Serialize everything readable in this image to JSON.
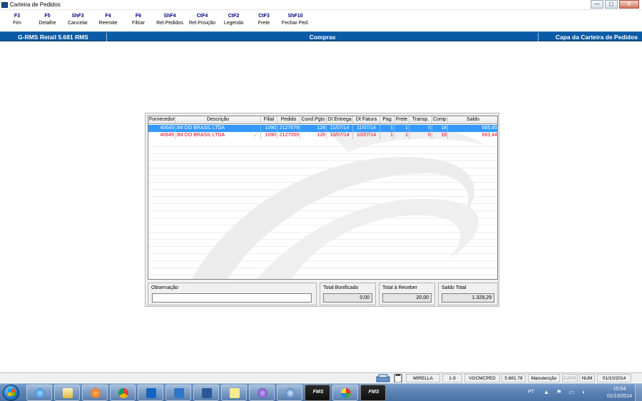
{
  "window": {
    "title": "Carteira de Pedidos",
    "controls": {
      "minimize": "—",
      "maximize": "◻",
      "close": "✕"
    }
  },
  "toolbar": [
    {
      "key": "F3",
      "label": "Fim"
    },
    {
      "key": "F5",
      "label": "Detalhe"
    },
    {
      "key": "ShF3",
      "label": "Cancelar"
    },
    {
      "key": "F4",
      "label": "Reemite"
    },
    {
      "key": "F6",
      "label": "Filtrar"
    },
    {
      "key": "ShF4",
      "label": "Rel.Pedidos"
    },
    {
      "key": "CtF4",
      "label": "Rel.Posição"
    },
    {
      "key": "CtF2",
      "label": "Legenda"
    },
    {
      "key": "CtF3",
      "label": "Frete"
    },
    {
      "key": "ShF10",
      "label": "Fechar Ped."
    }
  ],
  "header_bar": {
    "system": "G-RMS Retail 5.681 RMS",
    "module": "Compras",
    "screen": "Capa da Carteira de Pedidos",
    "color": "#0b5aa5"
  },
  "grid": {
    "columns": [
      "Fornecedor",
      "Descrição",
      "Filial",
      "Pedido",
      "Cond.Pgto",
      "Dt Entrega",
      "Dt Fatura",
      "Pag",
      "Frete",
      "Transp.",
      "Comp",
      "Saldo"
    ],
    "rows": [
      {
        "fornecedor": "40649",
        "descricao": "3M DO BRASIL LTDA",
        "checked": false,
        "filial": "1090",
        "pedido": "2127679",
        "cond_pgto": "128",
        "dt_entrega": "11/07/14",
        "dt_fatura": "11/07/14",
        "pag": "1",
        "frete": "1",
        "transp": "0",
        "comp": "18",
        "saldo": "665,85",
        "state": "selected"
      },
      {
        "fornecedor": "40649",
        "descricao": "3M DO BRASIL LTDA",
        "checked": true,
        "check_glyph": "✓",
        "filial": "1090",
        "pedido": "2127059",
        "cond_pgto": "128",
        "dt_entrega": "10/07/14",
        "dt_fatura": "10/07/14",
        "pag": "1",
        "frete": "1",
        "transp": "0",
        "comp": "18",
        "saldo": "663,44",
        "state": "red"
      }
    ],
    "selected_color": "#3399ff",
    "red_color": "#e0001b"
  },
  "observacao": {
    "label": "Observação",
    "value": ""
  },
  "totals": {
    "bonificado": {
      "label": "Total Bonificado",
      "value": "0,00"
    },
    "receber": {
      "label": "Total à Receber",
      "value": "20,00"
    },
    "saldo": {
      "label": "Saldo Total",
      "value": "1.329,29"
    }
  },
  "statusbar": {
    "user": "MIRELLA",
    "range": "1-9",
    "program": "VGCMCPED",
    "version": "5.681.78",
    "mode": "Manutenção",
    "caps": "CAPS",
    "num": "NUM",
    "date": "01/10/2014"
  },
  "taskbar": {
    "icons": [
      "windows-start-icon",
      "internet-explorer-icon",
      "file-explorer-icon",
      "media-player-icon",
      "chrome-icon",
      "outlook-icon",
      "lync-icon",
      "word-icon",
      "sticky-notes-icon",
      "infinity-app-icon",
      "update-icon",
      "fms-app-icon",
      "paint-icon",
      "fms-app-icon"
    ],
    "fms_label": "FMS",
    "lang": "PT",
    "time": "15:54",
    "date": "01/10/2014"
  }
}
